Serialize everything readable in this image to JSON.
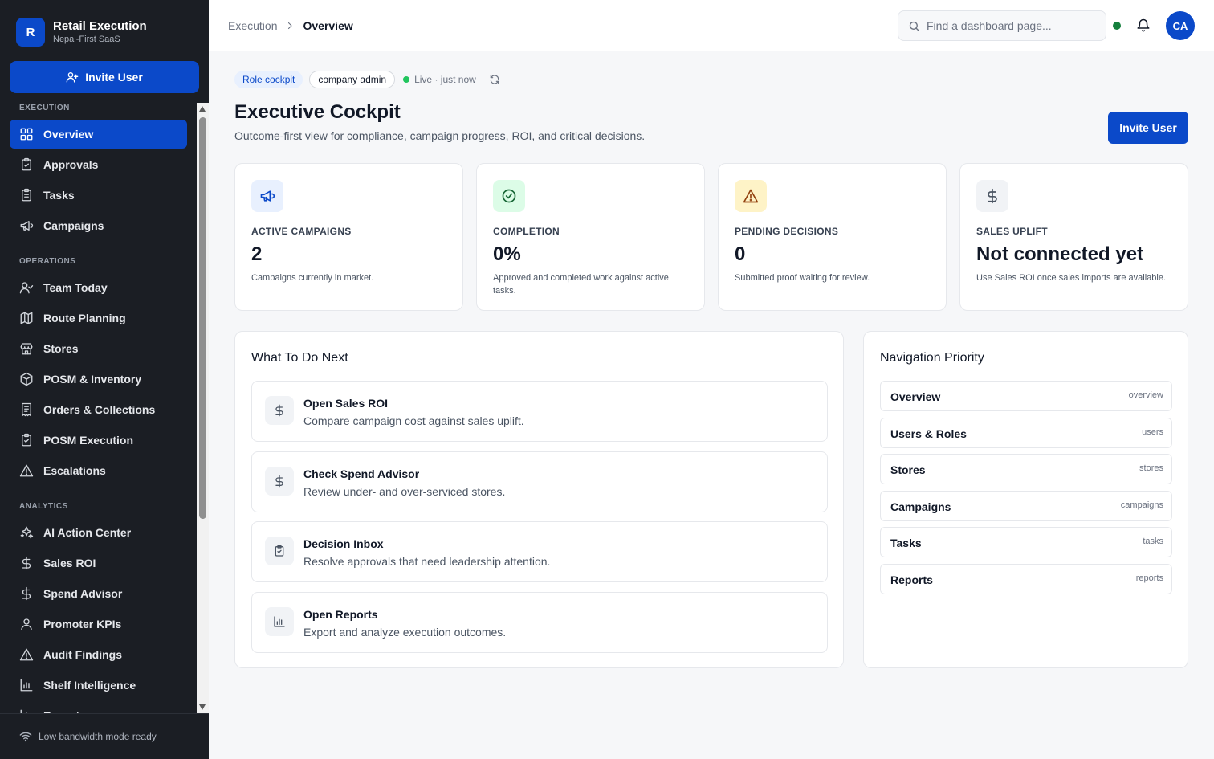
{
  "brand": {
    "initial": "R",
    "title": "Retail Execution",
    "subtitle": "Nepal-First SaaS"
  },
  "sidebar": {
    "invite_label": "Invite User",
    "sections": [
      {
        "label": "EXECUTION",
        "items": [
          {
            "label": "Overview",
            "icon": "grid-icon",
            "active": true
          },
          {
            "label": "Approvals",
            "icon": "clipboard-check-icon"
          },
          {
            "label": "Tasks",
            "icon": "clipboard-list-icon"
          },
          {
            "label": "Campaigns",
            "icon": "megaphone-icon"
          }
        ]
      },
      {
        "label": "OPERATIONS",
        "items": [
          {
            "label": "Team Today",
            "icon": "user-check-icon"
          },
          {
            "label": "Route Planning",
            "icon": "map-icon"
          },
          {
            "label": "Stores",
            "icon": "store-icon"
          },
          {
            "label": "POSM & Inventory",
            "icon": "package-icon"
          },
          {
            "label": "Orders & Collections",
            "icon": "receipt-icon"
          },
          {
            "label": "POSM Execution",
            "icon": "clipboard-check-icon"
          },
          {
            "label": "Escalations",
            "icon": "alert-triangle-icon"
          }
        ]
      },
      {
        "label": "ANALYTICS",
        "items": [
          {
            "label": "AI Action Center",
            "icon": "sparkles-icon"
          },
          {
            "label": "Sales ROI",
            "icon": "dollar-icon"
          },
          {
            "label": "Spend Advisor",
            "icon": "dollar-icon"
          },
          {
            "label": "Promoter KPIs",
            "icon": "user-icon"
          },
          {
            "label": "Audit Findings",
            "icon": "alert-triangle-icon"
          },
          {
            "label": "Shelf Intelligence",
            "icon": "bar-chart-icon"
          },
          {
            "label": "Reports",
            "icon": "bar-chart-icon"
          }
        ]
      }
    ],
    "footer": "Low bandwidth mode ready"
  },
  "header": {
    "breadcrumb_root": "Execution",
    "breadcrumb_current": "Overview",
    "search_placeholder": "Find a dashboard page...",
    "avatar_initials": "CA"
  },
  "main": {
    "chip_role": "Role cockpit",
    "chip_user": "company admin",
    "live_text": "Live · just now",
    "title": "Executive Cockpit",
    "subtitle": "Outcome-first view for compliance, campaign progress, ROI, and critical decisions.",
    "invite_label": "Invite User",
    "kpis": [
      {
        "label": "ACTIVE CAMPAIGNS",
        "value": "2",
        "desc": "Campaigns currently in market.",
        "icon": "megaphone-icon",
        "bg": "#e8f0fe",
        "fg": "#0b49c9"
      },
      {
        "label": "COMPLETION",
        "value": "0%",
        "desc": "Approved and completed work against active tasks.",
        "icon": "check-circle-icon",
        "bg": "#dcfce7",
        "fg": "#166534"
      },
      {
        "label": "PENDING DECISIONS",
        "value": "0",
        "desc": "Submitted proof waiting for review.",
        "icon": "alert-triangle-icon",
        "bg": "#fef3c7",
        "fg": "#92400e"
      },
      {
        "label": "SALES UPLIFT",
        "value": "Not connected yet",
        "desc": "Use Sales ROI once sales imports are available.",
        "icon": "dollar-icon",
        "bg": "#f1f3f6",
        "fg": "#4b5563"
      }
    ],
    "todo_title": "What To Do Next",
    "todos": [
      {
        "title": "Open Sales ROI",
        "desc": "Compare campaign cost against sales uplift.",
        "icon": "dollar-icon"
      },
      {
        "title": "Check Spend Advisor",
        "desc": "Review under- and over-serviced stores.",
        "icon": "dollar-icon"
      },
      {
        "title": "Decision Inbox",
        "desc": "Resolve approvals that need leadership attention.",
        "icon": "clipboard-check-icon"
      },
      {
        "title": "Open Reports",
        "desc": "Export and analyze execution outcomes.",
        "icon": "bar-chart-icon"
      }
    ],
    "priority_title": "Navigation Priority",
    "priorities": [
      {
        "label": "Overview",
        "key": "overview"
      },
      {
        "label": "Users & Roles",
        "key": "users"
      },
      {
        "label": "Stores",
        "key": "stores"
      },
      {
        "label": "Campaigns",
        "key": "campaigns"
      },
      {
        "label": "Tasks",
        "key": "tasks"
      },
      {
        "label": "Reports",
        "key": "reports"
      }
    ]
  }
}
